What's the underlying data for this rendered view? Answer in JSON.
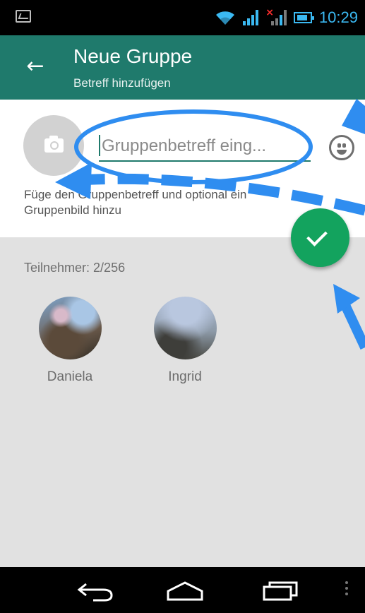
{
  "status_bar": {
    "time": "10:29",
    "icons": [
      "image-notification-icon",
      "wifi-icon",
      "signal-icon",
      "no-sim-signal-icon",
      "battery-icon"
    ]
  },
  "app_bar": {
    "title": "Neue Gruppe",
    "subtitle": "Betreff hinzufügen",
    "color": "#1f7a6c"
  },
  "group_info": {
    "subject_placeholder": "Gruppenbetreff eing...",
    "hint": "Füge den Gruppenbetreff und optional ein Gruppenbild hinzu"
  },
  "participants": {
    "label": "Teilnehmer: 2/256",
    "members": [
      {
        "name": "Daniela"
      },
      {
        "name": "Ingrid"
      }
    ]
  },
  "fab": {
    "icon": "check-icon",
    "color": "#13a35e"
  },
  "annotation_color": "#2f8df0"
}
